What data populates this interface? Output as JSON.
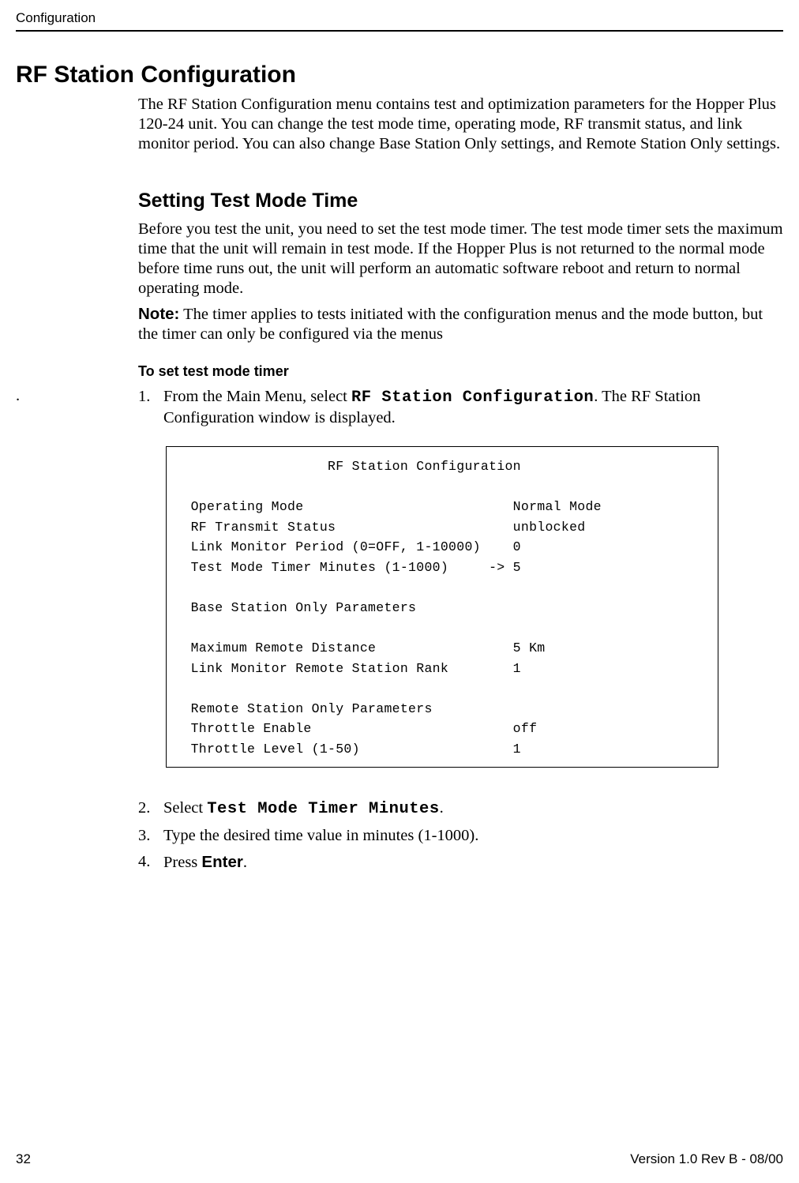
{
  "header": {
    "section": "Configuration"
  },
  "h1": "RF Station Configuration",
  "para_intro": "The RF Station Configuration menu contains test and optimization parameters for the Hopper Plus 120-24 unit. You can change the test mode time, operating mode, RF transmit status, and link monitor period. You can also change Base Station Only settings, and Remote Station Only settings.",
  "h2": "Setting Test Mode Time",
  "para_test_mode": "Before you test the unit, you need to set the test mode timer. The test mode timer sets the maximum time that the unit will remain in test mode. If the Hopper Plus is not returned to the normal mode before time runs out, the unit will perform an automatic software reboot and return to normal operating mode.",
  "note_label": "Note:",
  "note_text": " The timer applies to tests initiated with the configuration menus and the mode button, but the timer can only be configured via the menus",
  "h3": "To set test mode timer",
  "hanging_dot": ".",
  "step1": {
    "num": "1.",
    "pre": "From the Main Menu, select ",
    "code": "RF Station Configuration",
    "post": ". The RF Station Configuration window is displayed."
  },
  "terminal": "                    RF Station Configuration\n\n   Operating Mode                          Normal Mode\n   RF Transmit Status                      unblocked\n   Link Monitor Period (0=OFF, 1-10000)    0\n   Test Mode Timer Minutes (1-1000)     -> 5\n\n   Base Station Only Parameters\n\n   Maximum Remote Distance                 5 Km\n   Link Monitor Remote Station Rank        1\n\n   Remote Station Only Parameters\n   Throttle Enable                         off\n   Throttle Level (1-50)                   1",
  "step2": {
    "num": "2.",
    "pre": "Select ",
    "code": "Test Mode Timer Minutes",
    "post": "."
  },
  "step3": {
    "num": "3.",
    "text": "Type the desired time value in minutes (1-1000)."
  },
  "step4": {
    "num": "4.",
    "pre": "Press ",
    "bold": "Enter",
    "post": "."
  },
  "footer": {
    "page": "32",
    "version": "Version 1.0 Rev B - 08/00"
  }
}
